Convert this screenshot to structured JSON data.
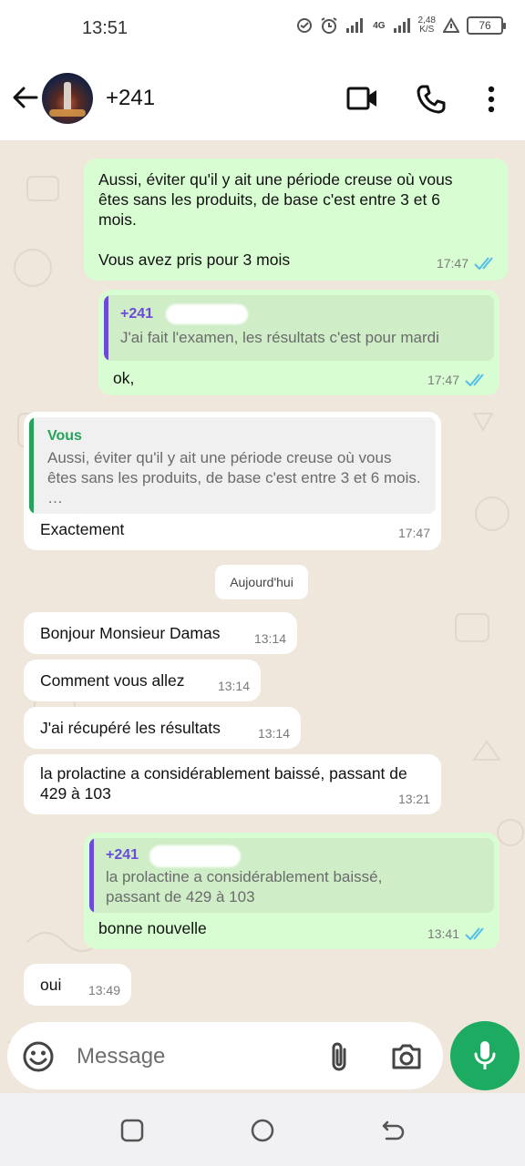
{
  "status_bar": {
    "time": "13:51",
    "network": "4G",
    "speed_value": "2,48",
    "speed_unit": "K/S",
    "battery": "76"
  },
  "header": {
    "contact_name": "+241",
    "icons": [
      "back-arrow-icon",
      "video-call-icon",
      "phone-icon",
      "more-options-icon"
    ]
  },
  "chat": {
    "date_divider": "Aujourd'hui",
    "messages": [
      {
        "direction": "out",
        "text": "Aussi, éviter qu'il y ait une période creuse où vous êtes sans les produits, de base c'est entre 3 et 6 mois.\n\nVous avez pris pour 3 mois",
        "time": "17:47",
        "status": "read"
      },
      {
        "direction": "out",
        "quote_author": "+241",
        "quote_text": "J'ai fait l'examen, les résultats c'est pour mardi",
        "text": "ok,",
        "time": "17:47",
        "status": "read"
      },
      {
        "direction": "in",
        "quote_author": "Vous",
        "quote_text": "Aussi, éviter qu'il y ait une période creuse où vous êtes sans les produits, de base c'est entre 3 et 6 mois. …",
        "text": "Exactement",
        "time": "17:47"
      },
      {
        "direction": "in",
        "text": "Bonjour Monsieur Damas",
        "time": "13:14"
      },
      {
        "direction": "in",
        "text": "Comment vous allez",
        "time": "13:14"
      },
      {
        "direction": "in",
        "text": "J'ai récupéré les résultats",
        "time": "13:14"
      },
      {
        "direction": "in",
        "text": "la prolactine a considérablement baissé, passant de 429 à 103",
        "time": "13:21"
      },
      {
        "direction": "out",
        "quote_author": "+241",
        "quote_text": "la prolactine a considérablement baissé, passant de 429 à 103",
        "text": "bonne nouvelle",
        "time": "13:41",
        "status": "read"
      },
      {
        "direction": "in",
        "text": "oui",
        "time": "13:49"
      }
    ]
  },
  "composer": {
    "placeholder": "Message",
    "icons": [
      "emoji-icon",
      "attach-icon",
      "camera-icon",
      "mic-icon"
    ]
  },
  "colors": {
    "accent_green": "#1daa61",
    "outgoing_bubble": "#d9fdd3",
    "incoming_bubble": "#ffffff",
    "chat_background": "#efe7dc",
    "read_ticks": "#53bdeb",
    "quote_out_bar": "#6b4bd8",
    "quote_in_bar": "#25a35a"
  }
}
